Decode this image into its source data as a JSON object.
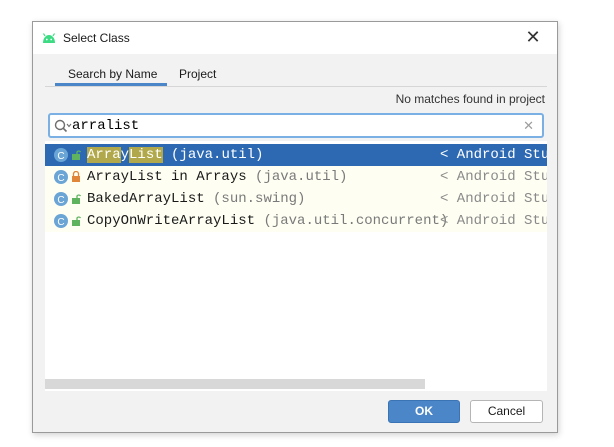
{
  "window": {
    "title": "Select Class",
    "app_icon": "android-icon",
    "close_glyph": "✕"
  },
  "tabs": [
    {
      "label": "Search by Name",
      "active": true
    },
    {
      "label": "Project",
      "active": false
    }
  ],
  "status_text": "No matches found in project",
  "search": {
    "value": "arralist",
    "clear_glyph": "✕"
  },
  "results": [
    {
      "highlight1": "Arra",
      "between": "y",
      "highlight2": "List",
      "name": "ArrayList",
      "package": "(java.util)",
      "module": "< Android Stu",
      "visibility": "public",
      "selected": true
    },
    {
      "name": "ArrayList in Arrays",
      "package": "(java.util)",
      "module": "< Android Stu",
      "visibility": "private",
      "selected": false
    },
    {
      "name": "BakedArrayList",
      "package": "(sun.swing)",
      "module": "< Android Stu",
      "visibility": "public",
      "selected": false
    },
    {
      "name": "CopyOnWriteArrayList",
      "package": "(java.util.concurrent)",
      "module": "< Android Stu",
      "visibility": "public",
      "selected": false
    }
  ],
  "buttons": {
    "ok": "OK",
    "cancel": "Cancel"
  },
  "colors": {
    "accent": "#4a86c8",
    "selection": "#2d69b3",
    "row_bg": "#fefef2",
    "match_highlight": "#b0a84a"
  }
}
